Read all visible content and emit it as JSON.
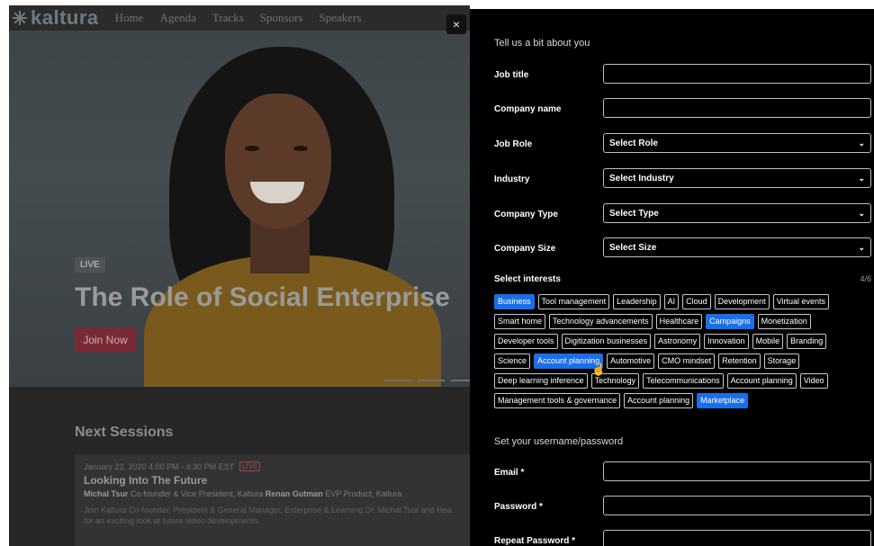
{
  "site": {
    "logo": "kaltura",
    "nav": [
      "Home",
      "Agenda",
      "Tracks",
      "Sponsors",
      "Speakers"
    ],
    "hero": {
      "live_label": "LIVE",
      "title": "The Role of Social Enterprise",
      "join_label": "Join Now"
    },
    "next": {
      "title": "Next Sessions",
      "session": {
        "date": "January 22, 2020  4:00 PM - 4:30 PM EST",
        "live": "LIVE",
        "title": "Looking Into The Future",
        "speaker1_name": "Michal Tsur",
        "speaker1_role": "Co-founder & Vice President, Kaltura",
        "speaker2_name": "Renan Gutman",
        "speaker2_role": "EVP Product, Kaltura",
        "desc1": "Join Kaltura Co-founder, President & General Manager, Enterprise & Learning Dr. Michal Tsur and Hea",
        "desc2": "for an exciting look at future video developments."
      }
    },
    "close_label": "×"
  },
  "panel": {
    "about_title": "Tell us a bit about you",
    "fields": {
      "job_title": "Job title",
      "company_name": "Company name",
      "job_role": "Job Role",
      "industry": "Industry",
      "company_type": "Company Type",
      "company_size": "Company Size"
    },
    "selects": {
      "role": "Select Role",
      "industry": "Select Industry",
      "type": "Select Type",
      "size": "Select Size"
    },
    "interests": {
      "label": "Select interests",
      "count": "4/6",
      "rows": [
        [
          {
            "t": "Business",
            "s": true
          },
          {
            "t": "Tool management"
          },
          {
            "t": "Leadership"
          },
          {
            "t": "AI"
          },
          {
            "t": "Cloud"
          },
          {
            "t": "Development"
          },
          {
            "t": "Virtual events"
          }
        ],
        [
          {
            "t": "Smart home"
          },
          {
            "t": "Technology advancements"
          },
          {
            "t": "Healthcare"
          },
          {
            "t": "Campaigns",
            "s": true
          },
          {
            "t": "Monetization"
          }
        ],
        [
          {
            "t": "Developer tools"
          },
          {
            "t": "Digitization  businesses"
          },
          {
            "t": "Astronomy"
          },
          {
            "t": "Innovation"
          },
          {
            "t": "Mobile"
          },
          {
            "t": "Branding"
          }
        ],
        [
          {
            "t": "Science"
          },
          {
            "t": "Account planning",
            "s": true
          },
          {
            "t": "Automotive"
          },
          {
            "t": "CMO mindset"
          },
          {
            "t": "Retention"
          },
          {
            "t": "Storage"
          }
        ],
        [
          {
            "t": "Deep learning inference"
          },
          {
            "t": "Technology"
          },
          {
            "t": "Telecommunications"
          },
          {
            "t": "Account planning"
          },
          {
            "t": "Video"
          }
        ],
        [
          {
            "t": "Management tools & governance"
          },
          {
            "t": "Account planning"
          },
          {
            "t": "Marketplace",
            "s": true
          }
        ]
      ]
    },
    "credentials_title": "Set your username/password",
    "email_label": "Email *",
    "password_label": "Password *",
    "repeat_label": "Repeat Password *"
  },
  "colors": {
    "selected_tag": "#1a6fe8",
    "panel_bg": "#000000",
    "join_button": "#7a2a34"
  },
  "icons": [
    "kaltura-logo-icon",
    "close-icon",
    "chevron-down-icon",
    "hand-pointer-icon"
  ]
}
